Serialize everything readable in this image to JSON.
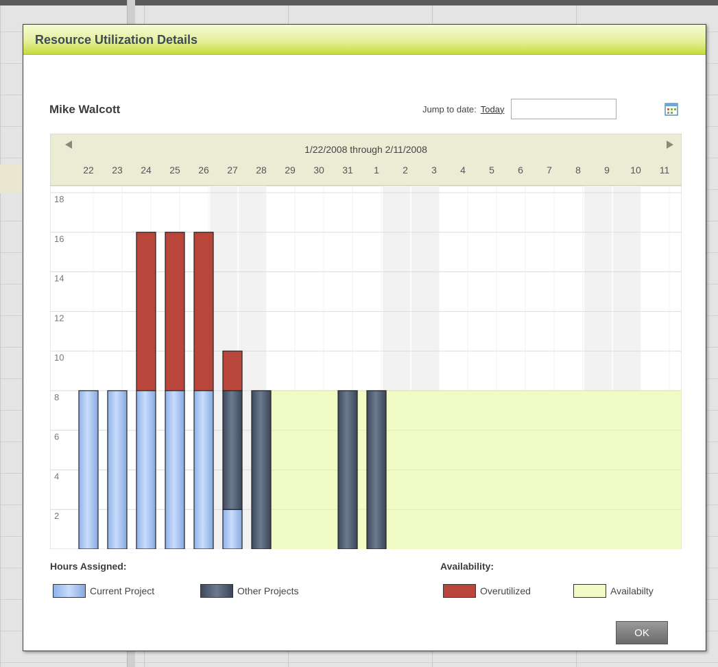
{
  "dialog": {
    "title": "Resource Utilization Details",
    "person_name": "Mike Walcott",
    "jump_label": "Jump to date:",
    "today_link": "Today",
    "date_value": "",
    "ok_label": "OK"
  },
  "colors": {
    "current_project": "#a7c6f4",
    "other_projects": "#4d5a6e",
    "overutilized": "#b9463a",
    "availability": "#f1fbc6",
    "header_accent": "#c7dc3c"
  },
  "chart_data": {
    "type": "bar",
    "range_label": "1/22/2008 through 2/11/2008",
    "categories": [
      "22",
      "23",
      "24",
      "25",
      "26",
      "27",
      "28",
      "29",
      "30",
      "31",
      "1",
      "2",
      "3",
      "4",
      "5",
      "6",
      "7",
      "8",
      "9",
      "10",
      "11"
    ],
    "weekend_indices": [
      5,
      6,
      11,
      12,
      18,
      19
    ],
    "series": [
      {
        "name": "Current Project",
        "values": [
          8,
          8,
          8,
          8,
          8,
          2,
          0,
          0,
          0,
          0,
          0,
          0,
          0,
          0,
          0,
          0,
          0,
          0,
          0,
          0,
          0
        ]
      },
      {
        "name": "Other Projects",
        "values": [
          0,
          0,
          0,
          0,
          0,
          6,
          8,
          0,
          0,
          8,
          8,
          0,
          0,
          0,
          0,
          0,
          0,
          0,
          0,
          0,
          0
        ]
      },
      {
        "name": "Overutilized",
        "values": [
          0,
          0,
          8,
          8,
          8,
          2,
          0,
          0,
          0,
          0,
          0,
          0,
          0,
          0,
          0,
          0,
          0,
          0,
          0,
          0,
          0
        ]
      },
      {
        "name": "Availability",
        "values": [
          0,
          0,
          0,
          0,
          0,
          0,
          0,
          8,
          8,
          0,
          0,
          8,
          8,
          8,
          8,
          8,
          8,
          8,
          8,
          8,
          8
        ]
      }
    ],
    "y_ticks": [
      2,
      4,
      6,
      8,
      10,
      12,
      14,
      16,
      18
    ],
    "ylim": [
      0,
      18
    ],
    "grid": true
  },
  "legend": {
    "hours_title": "Hours Assigned:",
    "availability_title": "Availability:",
    "items": [
      {
        "label": "Current Project"
      },
      {
        "label": "Other Projects"
      },
      {
        "label": "Overutilized"
      },
      {
        "label": "Availabilty"
      }
    ]
  }
}
